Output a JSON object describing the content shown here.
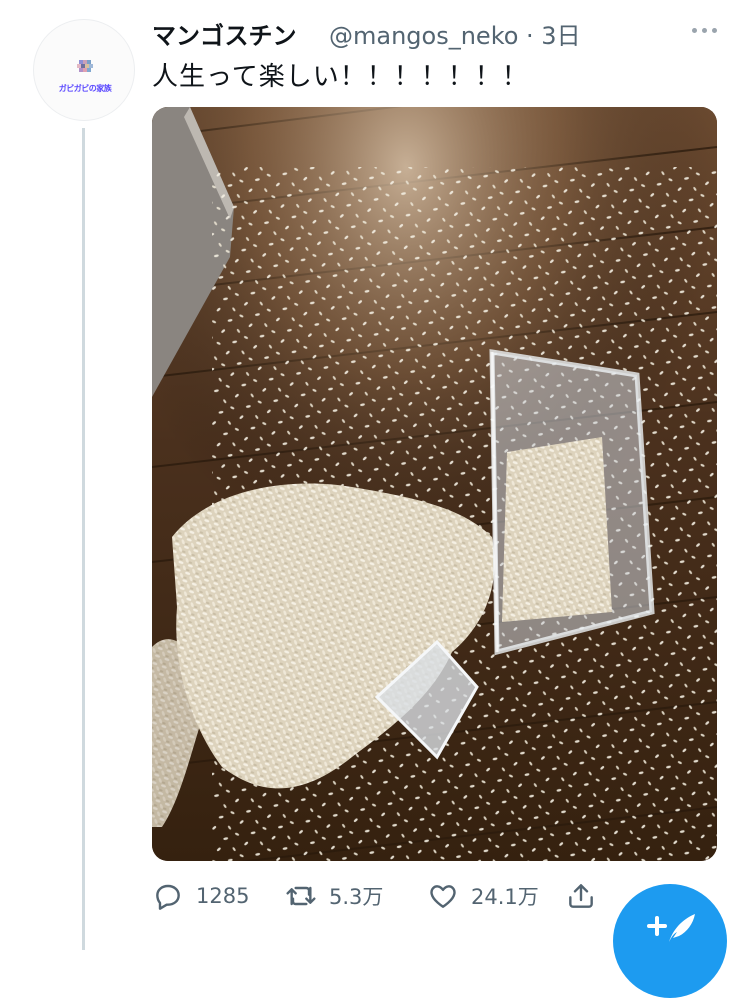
{
  "tweet": {
    "display_name": "マンゴスチン",
    "handle_time": "@mangos_neko · 3日",
    "text": "人生って楽しい！！！！！！！",
    "avatar_banner": "ガビガビの家族",
    "media_alt": "photo of rice spilled on a wooden floor from a clear plastic container"
  },
  "actions": {
    "reply_count": "1285",
    "retweet_count": "5.3万",
    "like_count": "24.1万"
  },
  "icons": {
    "more": "more-horizontal-icon",
    "reply": "reply-icon",
    "retweet": "retweet-icon",
    "like": "heart-icon",
    "share": "share-icon",
    "compose": "compose-tweet-icon"
  },
  "colors": {
    "accent": "#1d9bf0",
    "secondary_text": "#536471",
    "thread_line": "#cfd9de"
  }
}
